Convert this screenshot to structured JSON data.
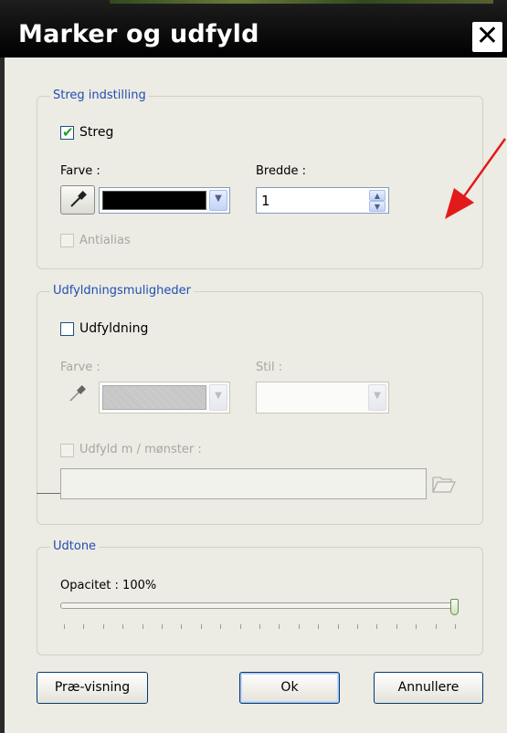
{
  "window": {
    "title": "Marker og udfyld",
    "close_glyph": "✕"
  },
  "stroke": {
    "legend": "Streg indstilling",
    "enable_label": "Streg",
    "enabled": true,
    "color_label": "Farve :",
    "color_value": "#000000",
    "width_label": "Bredde :",
    "width_value": "1",
    "antialias_label": "Antialias"
  },
  "fill": {
    "legend": "Udfyldningsmuligheder",
    "enable_label": "Udfyldning",
    "enabled": false,
    "color_label": "Farve :",
    "style_label": "Stil :",
    "pattern_label": "Udfyld m / mønster :",
    "pattern_path": ""
  },
  "tone": {
    "legend": "Udtone",
    "opacity_label": "Opacitet : 100%",
    "opacity_value": 1.0
  },
  "buttons": {
    "preview": "Præ-visning",
    "ok": "Ok",
    "cancel": "Annullere"
  },
  "icons": {
    "eyedropper": "eyedropper-icon",
    "dropdown": "chevron-down-icon",
    "spinner_up": "arrow-up-icon",
    "spinner_down": "arrow-down-icon",
    "folder": "folder-open-icon",
    "checkmark": "check-icon",
    "close": "close-icon"
  },
  "annotation": {
    "arrow_color": "#e21a1a"
  }
}
